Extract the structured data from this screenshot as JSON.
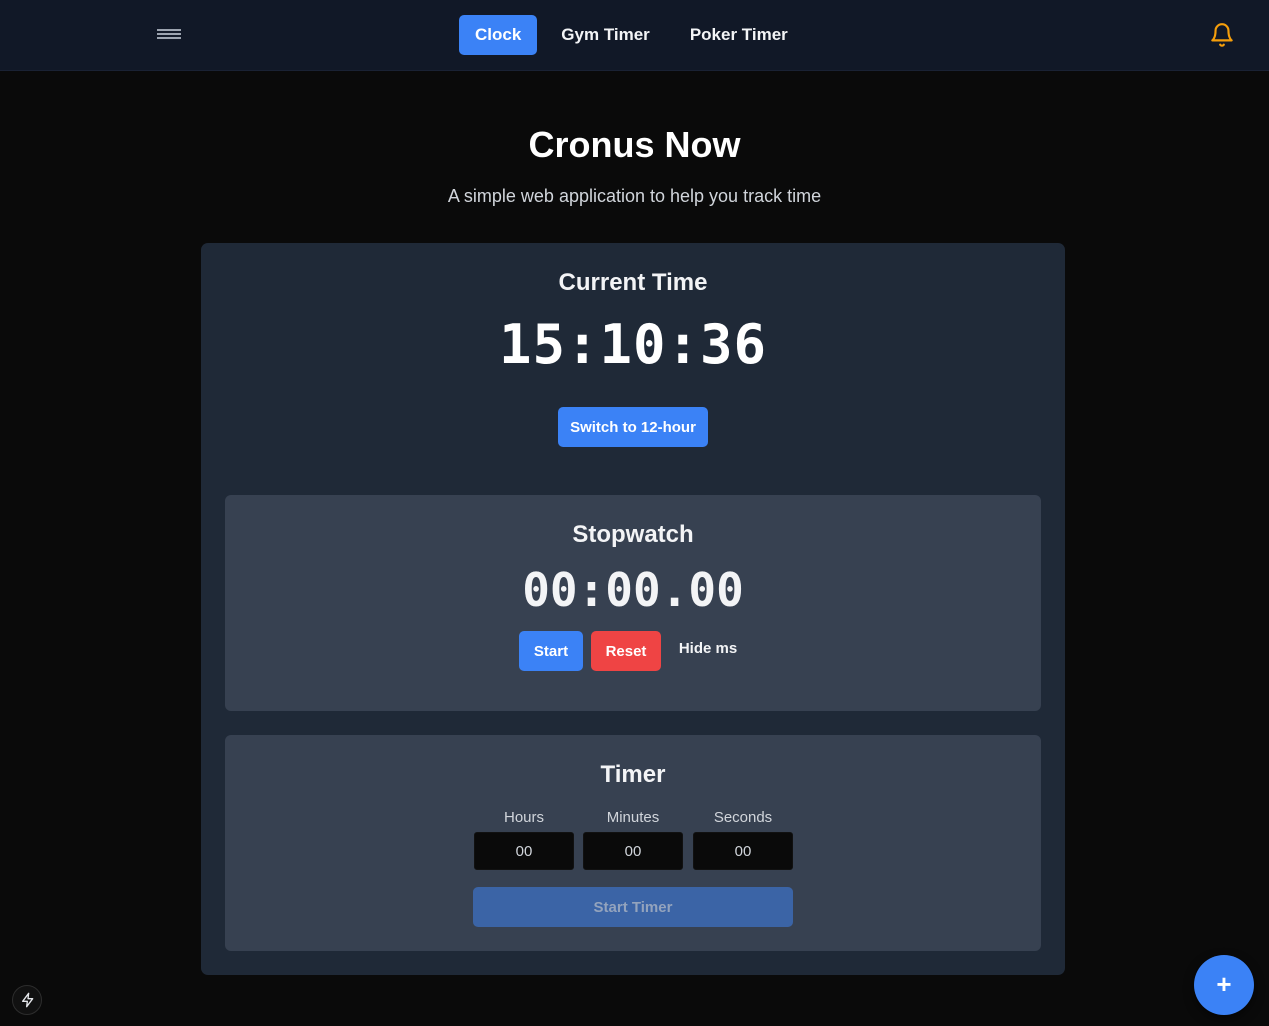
{
  "nav": {
    "tabs": [
      {
        "label": "Clock",
        "active": true
      },
      {
        "label": "Gym Timer",
        "active": false
      },
      {
        "label": "Poker Timer",
        "active": false
      }
    ],
    "menu_icon": "hamburger-icon",
    "notification_icon": "bell-icon"
  },
  "header": {
    "title": "Cronus Now",
    "subtitle": "A simple web application to help you track time"
  },
  "clock": {
    "title": "Current Time",
    "time": "15:10:36",
    "toggle_label": "Switch to 12-hour"
  },
  "stopwatch": {
    "title": "Stopwatch",
    "time": "00:00.00",
    "start_label": "Start",
    "reset_label": "Reset",
    "hide_ms_label": "Hide ms"
  },
  "timer": {
    "title": "Timer",
    "hours_label": "Hours",
    "minutes_label": "Minutes",
    "seconds_label": "Seconds",
    "hours_value": "00",
    "minutes_value": "00",
    "seconds_value": "00",
    "start_label": "Start Timer"
  },
  "fab": {
    "label": "+"
  },
  "colors": {
    "accent": "#3b82f6",
    "danger": "#ef4444",
    "bell": "#f59e0b",
    "card": "#1f2937",
    "panel": "#374151"
  }
}
